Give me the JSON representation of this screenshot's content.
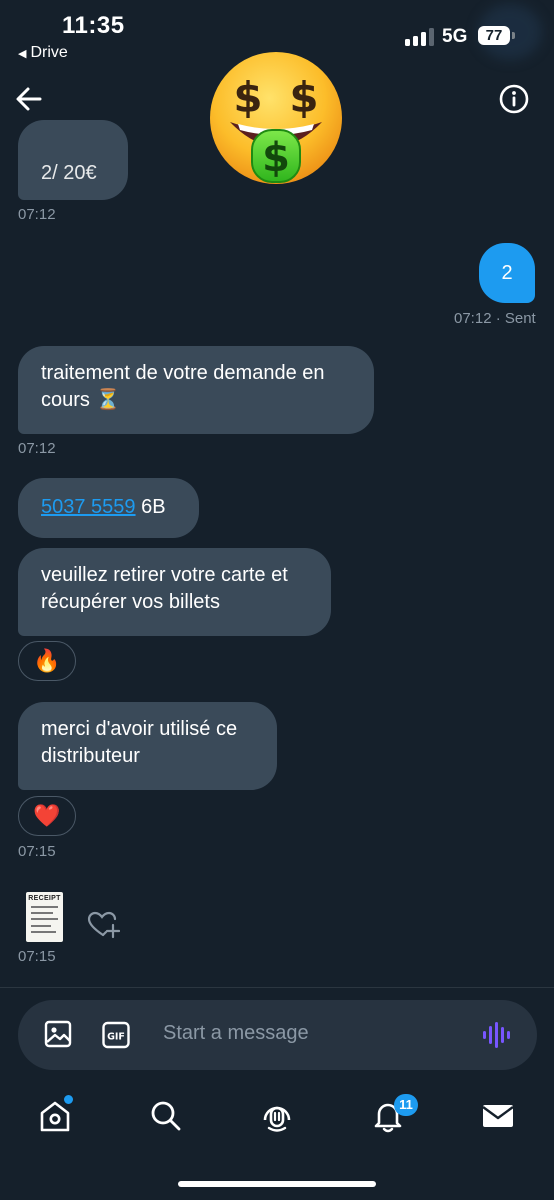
{
  "status_bar": {
    "time": "11:35",
    "back_app": "Drive",
    "network": "5G",
    "battery": "77"
  },
  "conversation": {
    "partial_message_text": "2/ 20€",
    "partial_message_time": "07:12",
    "sent_message": {
      "text": "2",
      "time": "07:12 · Sent"
    },
    "messages": [
      {
        "text": "traitement de votre demande en cours ⏳",
        "time": "07:12"
      },
      {
        "link": "5037 5559",
        "suffix": " 6B"
      },
      {
        "text": "veuillez retirer votre carte et récupérer vos billets",
        "reaction": "🔥"
      },
      {
        "text": "merci d'avoir utilisé ce distributeur",
        "reaction": "❤️",
        "time": "07:15"
      }
    ],
    "receipt": {
      "title": "RECEIPT",
      "time": "07:15"
    }
  },
  "composer": {
    "placeholder": "Start a message"
  },
  "tab_bar": {
    "notifications_badge": "11"
  },
  "colors": {
    "background": "#15202b",
    "incoming_bubble": "#3a4a59",
    "accent": "#1d9bf0",
    "voice_icon": "#7856ff"
  }
}
